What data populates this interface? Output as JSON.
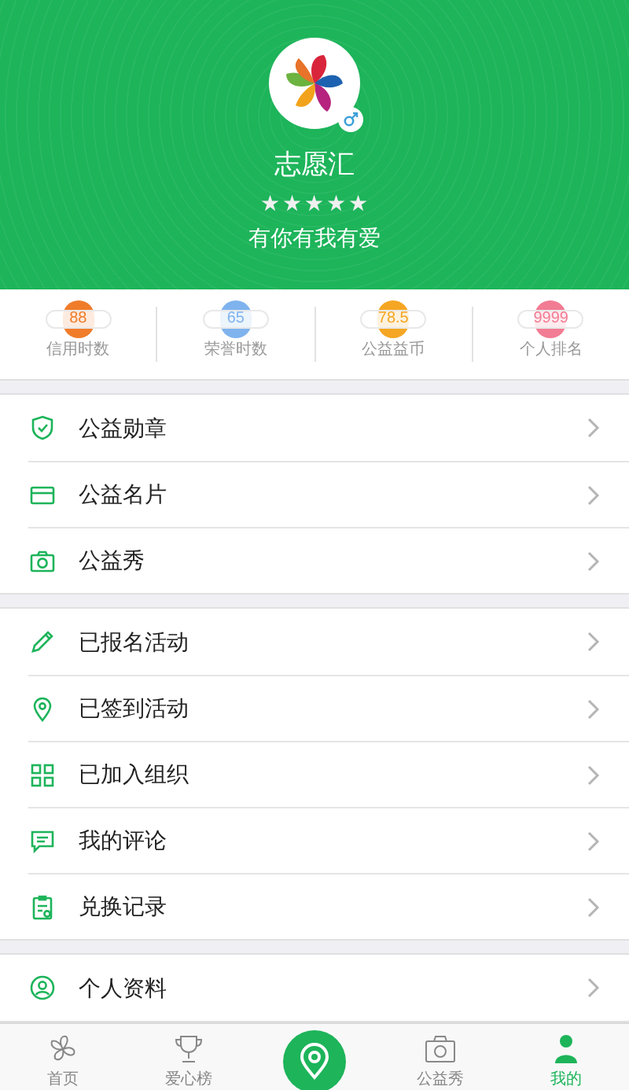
{
  "profile": {
    "name": "志愿汇",
    "stars": 5,
    "motto": "有你有我有爱"
  },
  "stats": [
    {
      "value": "88",
      "label": "信用时数",
      "color": "#f07c2a"
    },
    {
      "value": "65",
      "label": "荣誉时数",
      "color": "#7fb3ee"
    },
    {
      "value": "78.5",
      "label": "公益益币",
      "color": "#f5a623"
    },
    {
      "value": "9999",
      "label": "个人排名",
      "color": "#f27c93"
    }
  ],
  "menu_groups": [
    [
      {
        "label": "公益勋章"
      },
      {
        "label": "公益名片"
      },
      {
        "label": "公益秀"
      }
    ],
    [
      {
        "label": "已报名活动"
      },
      {
        "label": "已签到活动"
      },
      {
        "label": "已加入组织"
      },
      {
        "label": "我的评论"
      },
      {
        "label": "兑换记录"
      }
    ],
    [
      {
        "label": "个人资料"
      }
    ]
  ],
  "tab_bar": [
    {
      "label": "首页",
      "selected": false
    },
    {
      "label": "爱心榜",
      "selected": false
    },
    {
      "kind": "center",
      "selected": false
    },
    {
      "label": "公益秀",
      "selected": false
    },
    {
      "label": "我的",
      "selected": true
    }
  ]
}
